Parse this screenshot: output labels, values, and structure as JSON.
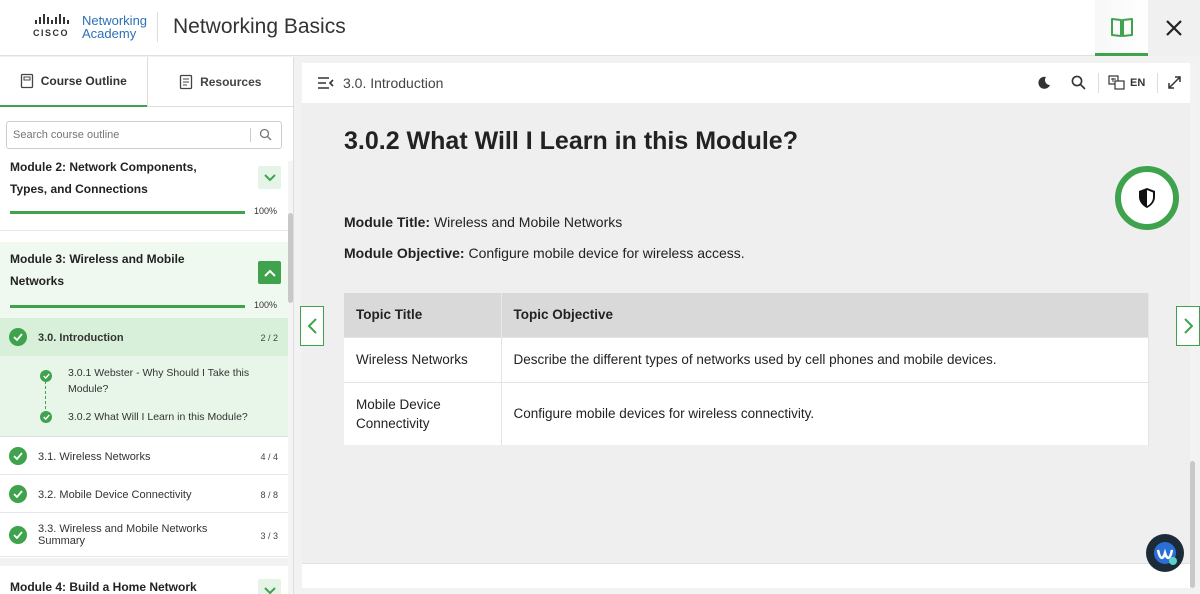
{
  "header": {
    "logo_cisco": "CISCO",
    "logo_line1": "Networking",
    "logo_line2": "Academy",
    "title": "Networking Basics",
    "book_icon": "book-icon",
    "close_icon": "close-icon"
  },
  "sidebar": {
    "tabs": [
      {
        "label": "Course Outline",
        "icon": "document-icon"
      },
      {
        "label": "Resources",
        "icon": "document-lines-icon"
      }
    ],
    "search": {
      "placeholder": "Search course outline",
      "icon": "search-icon"
    },
    "modules": [
      {
        "title_line1": "Module 2: Network Components,",
        "title_line2": "Types, and Connections",
        "progress": "100%",
        "expanded": false
      },
      {
        "title_line1": "Module 3: Wireless and Mobile",
        "title_line2": "Networks",
        "progress": "100%",
        "expanded": true
      },
      {
        "title_line1": "Module 4: Build a Home Network",
        "expanded": false
      }
    ],
    "sections": [
      {
        "label": "3.0. Introduction",
        "count": "2 / 2",
        "active": true
      },
      {
        "label": "3.1. Wireless Networks",
        "count": "4 / 4"
      },
      {
        "label": "3.2. Mobile Device Connectivity",
        "count": "8 / 8"
      },
      {
        "label_line1": "3.3. Wireless and Mobile Networks",
        "label_line2": "Summary",
        "count": "3 / 3"
      }
    ],
    "subitems": [
      {
        "line1": "3.0.1 Webster - Why Should I Take this",
        "line2": "Module?"
      },
      {
        "line1": "3.0.2 What Will I Learn in this Module?"
      }
    ]
  },
  "main": {
    "breadcrumb": "3.0. Introduction",
    "language": "EN",
    "heading": "3.0.2 What Will I Learn in this Module?",
    "module_title_label": "Module Title:",
    "module_title_value": "Wireless and Mobile Networks",
    "module_objective_label": "Module Objective:",
    "module_objective_value": "Configure mobile device for wireless access.",
    "table": {
      "headers": [
        "Topic Title",
        "Topic Objective"
      ],
      "rows": [
        {
          "title": "Wireless Networks",
          "objective": "Describe the different types of networks used by cell phones and mobile devices."
        },
        {
          "title_line1": "Mobile Device",
          "title_line2": "Connectivity",
          "objective": "Configure mobile devices for wireless connectivity."
        }
      ]
    }
  },
  "colors": {
    "accent": "#3fa34d",
    "brand_blue": "#2b71b8"
  }
}
